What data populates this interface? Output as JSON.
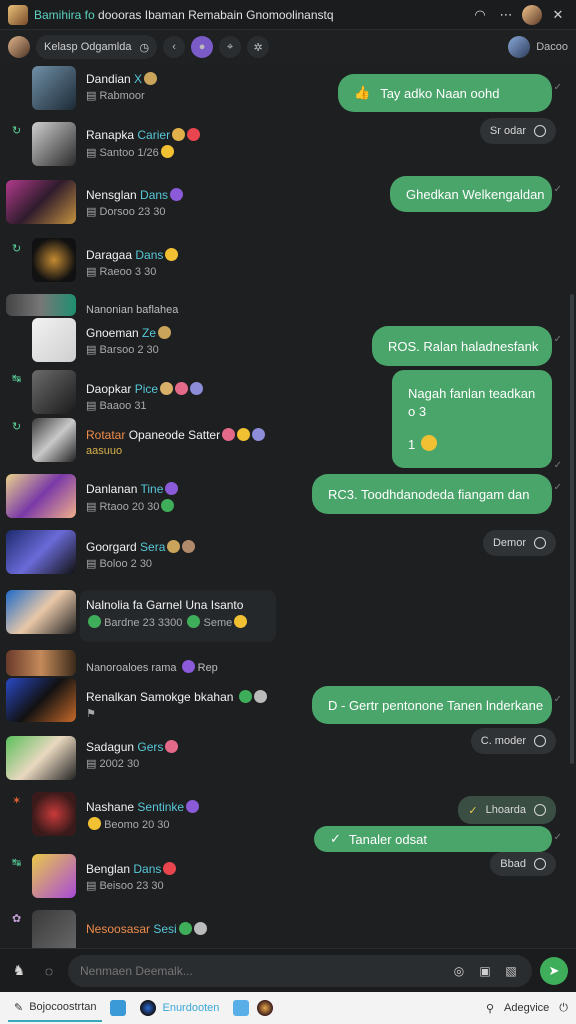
{
  "window": {
    "title_prefix": "Bamihira fo",
    "title_rest": "doooras Ibaman Remabain Gnomoolinanstq",
    "close_label": "✕"
  },
  "subbar": {
    "search_label": "Kelasp Odgamlda",
    "right_label": "Dacoo"
  },
  "feed": [
    {
      "kind": "item",
      "name": "Dandian",
      "tag": "X",
      "meta": "Rabmoor",
      "meta2": ""
    },
    {
      "kind": "item",
      "name": "Ranapka",
      "tag": "Carier",
      "meta": "Santoo 1/26",
      "meta2": ""
    },
    {
      "kind": "item",
      "name": "Nensglan",
      "tag": "Dans",
      "meta": "Dorsoo 23 30",
      "meta2": ""
    },
    {
      "kind": "item",
      "name": "Daragaa",
      "tag": "Dans",
      "meta": "Raeoo 3 30",
      "meta2": ""
    },
    {
      "kind": "item",
      "name": "Nanonian baflahea",
      "tag": "",
      "meta": "",
      "meta2": ""
    },
    {
      "kind": "item",
      "name": "Gnoeman",
      "tag": "Ze",
      "meta": "Barsoo 2 30",
      "meta2": ""
    },
    {
      "kind": "item",
      "name": "Daopkar",
      "tag": "Pice",
      "meta": "Baaoo 31",
      "meta2": ""
    },
    {
      "kind": "item",
      "name": "Rotatar",
      "tag": "Opaneode Satter",
      "meta": "aasuuo",
      "meta2": ""
    },
    {
      "kind": "item",
      "name": "Danlanan",
      "tag": "Tine",
      "meta": "Rtaoo 20 30",
      "meta2": ""
    },
    {
      "kind": "item",
      "name": "Goorgard",
      "tag": "Sera",
      "meta": "Boloo 2 30",
      "meta2": ""
    },
    {
      "kind": "item",
      "name": "Nalnolia fa Garnel Una Isanto",
      "tag": "",
      "meta": "Bardne 23 3300",
      "meta2": "Seme"
    },
    {
      "kind": "item",
      "name": "Nanoroaloes rama",
      "tag": "Rep",
      "meta": "",
      "meta2": ""
    },
    {
      "kind": "item",
      "name": "Renalkan Samokge bkahan",
      "tag": "",
      "meta": "",
      "meta2": ""
    },
    {
      "kind": "item",
      "name": "Sadagun",
      "tag": "Gers",
      "meta": "2002 30",
      "meta2": ""
    },
    {
      "kind": "item",
      "name": "Nashane",
      "tag": "Sentinke",
      "meta": "Beomo 20 30",
      "meta2": ""
    },
    {
      "kind": "item",
      "name": "Benglan",
      "tag": "Dans",
      "meta": "Beisoo 23 30",
      "meta2": ""
    },
    {
      "kind": "item",
      "name": "Nesoosasar",
      "tag": "Sesi",
      "meta": "",
      "meta2": ""
    }
  ],
  "messages": [
    {
      "type": "bubble",
      "text": "Tay adko Naan oohd",
      "icon": "👍"
    },
    {
      "type": "pill",
      "text": "Sr odar"
    },
    {
      "type": "bubble",
      "text": "Ghedkan Welkengaldan",
      "icon": ""
    },
    {
      "type": "bubble",
      "text": "ROS. Ralan haladnesfank",
      "icon": ""
    },
    {
      "type": "bubble",
      "text": "Nagah fanlan teadkan o 3",
      "icon": "",
      "extra": "1"
    },
    {
      "type": "bubble",
      "text": "RC3. Toodhdanodeda fiangam dan",
      "icon": ""
    },
    {
      "type": "pill",
      "text": "Demor"
    },
    {
      "type": "bubble",
      "text": "D - Gertr pentonone Tanen lnderkane",
      "icon": ""
    },
    {
      "type": "pill",
      "text": "C. moder"
    },
    {
      "type": "pill",
      "text": "Lhoarda"
    },
    {
      "type": "bubble",
      "text": "Tanaler odsat",
      "icon": "✓"
    },
    {
      "type": "pill",
      "text": "Bbad"
    }
  ],
  "composer": {
    "placeholder": "Nenmaen Deemalk..."
  },
  "taskbar": {
    "items": [
      "Bojocoostrtan",
      "Enurdooten"
    ],
    "right_label": "Adegvice"
  },
  "colors": {
    "accent_green": "#4aa56a",
    "tag_teal": "#57c8d8",
    "tag_orange": "#f08c4a"
  }
}
